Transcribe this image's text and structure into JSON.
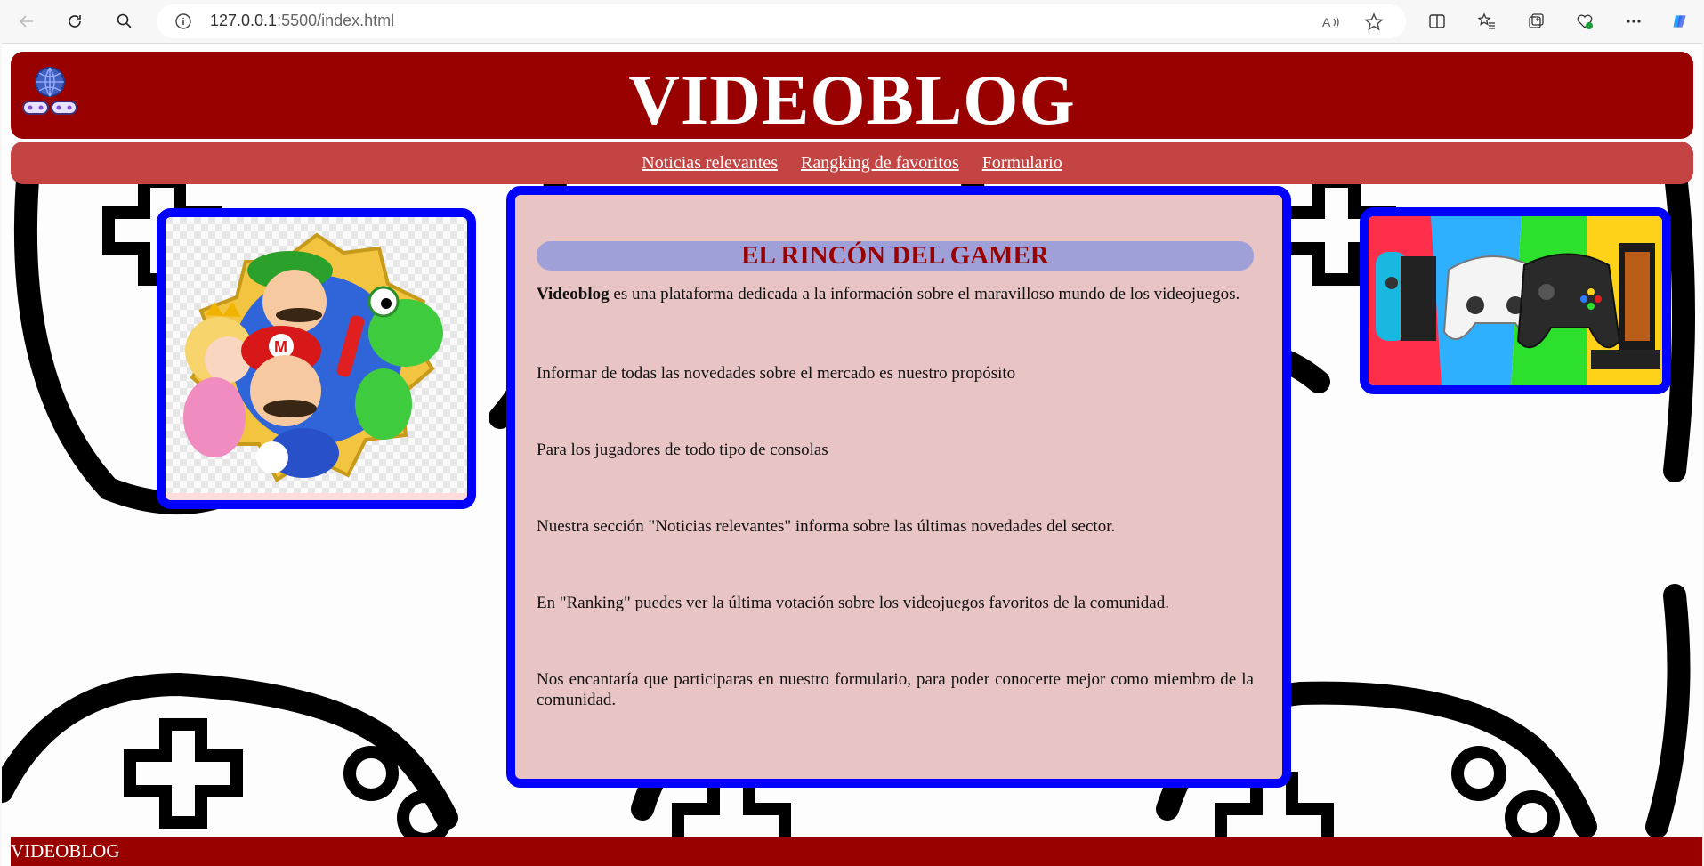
{
  "browser": {
    "url_host": "127.0.0.1",
    "url_path": ":5500/index.html"
  },
  "header": {
    "title": "VIDEOBLOG",
    "logo_icon": "globe-gamepad-icon"
  },
  "nav": {
    "items": [
      {
        "label": "Noticias relevantes"
      },
      {
        "label": "Rangking de favoritos"
      },
      {
        "label": "Formulario"
      }
    ]
  },
  "main": {
    "heading": "EL RINCÓN DEL GAMER",
    "intro_bold": "Videoblog",
    "intro_rest": " es una plataforma dedicada a la información sobre el maravilloso mundo de los videojuegos.",
    "paragraphs": [
      "Informar de todas las novedades sobre el mercado es nuestro propósito",
      "Para los jugadores de todo tipo de consolas",
      "Nuestra sección \"Noticias relevantes\" informa sobre las últimas novedades del sector.",
      "En \"Ranking\" puedes ver la última votación sobre los videojuegos favoritos de la comunidad.",
      "Nos encantaría que participaras en nuestro formulario, para poder conocerte mejor como miembro de la comunidad."
    ]
  },
  "footer": {
    "text": "VIDEOBLOG"
  },
  "colors": {
    "header_bg": "#990000",
    "nav_bg": "#c44444",
    "frame_border": "#0000ff",
    "content_bg": "#e8c4c4",
    "heading_bg": "#a0a0d8"
  }
}
